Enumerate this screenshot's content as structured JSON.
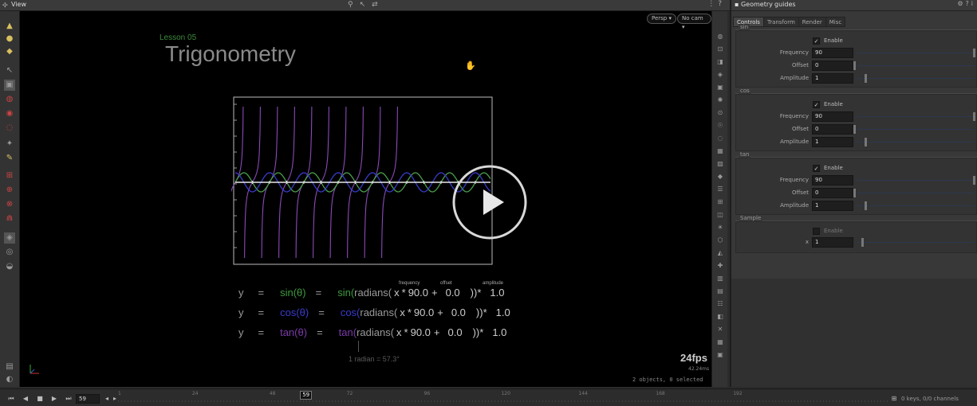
{
  "topbar": {
    "tab_title": "View"
  },
  "viewport": {
    "persp_label": "Persp",
    "cam_label": "No cam",
    "lesson": "Lesson 05",
    "title": "Trigonometry",
    "equations": [
      {
        "y": "y",
        "eq1": "=",
        "func": "sin(θ)",
        "eq2": "=",
        "func2": "sin(",
        "radians": "radians(",
        "x": "x",
        "times": "*",
        "freq": "90.0",
        "plus": "+",
        "offset": "0.0",
        "close": "))",
        "times2": "*",
        "amp": "1.0",
        "color": "#3e9a3e"
      },
      {
        "y": "y",
        "eq1": "=",
        "func": "cos(θ)",
        "eq2": "=",
        "func2": "cos(",
        "radians": "radians(",
        "x": "x",
        "times": "*",
        "freq": "90.0",
        "plus": "+",
        "offset": "0.0",
        "close": "))",
        "times2": "*",
        "amp": "1.0",
        "color": "#3b3bcc"
      },
      {
        "y": "y",
        "eq1": "=",
        "func": "tan(θ)",
        "eq2": "=",
        "func2": "tan(",
        "radians": "radians(",
        "x": "x",
        "times": "*",
        "freq": "90.0",
        "plus": "+",
        "offset": "0.0",
        "close": "))",
        "times2": "*",
        "amp": "1.0",
        "color": "#7a3aa8"
      }
    ],
    "label_frequency": "frequency",
    "label_offset": "offset",
    "label_amplitude": "amplitude",
    "radian_note": "1 radian = 57.3°",
    "fps": "24fps",
    "ms": "42.24ms",
    "objects": "2 objects, 0 selected",
    "colors": {
      "sin": "#4aa04a",
      "cos": "#3a3acc",
      "tan": "#8a4ab8",
      "axis": "#e0e0e0"
    }
  },
  "panel": {
    "type_label": "Geometry",
    "node_name": "guides",
    "tabs": [
      "Controls",
      "Transform",
      "Render",
      "Misc"
    ],
    "folders": [
      {
        "label": "sin",
        "enable": "Enable",
        "enabled": true,
        "params": [
          {
            "label": "Frequency",
            "value": "90"
          },
          {
            "label": "Offset",
            "value": "0"
          },
          {
            "label": "Amplitude",
            "value": "1"
          }
        ]
      },
      {
        "label": "cos",
        "enable": "Enable",
        "enabled": true,
        "params": [
          {
            "label": "Frequency",
            "value": "90"
          },
          {
            "label": "Offset",
            "value": "0"
          },
          {
            "label": "Amplitude",
            "value": "1"
          }
        ]
      },
      {
        "label": "tan",
        "enable": "Enable",
        "enabled": true,
        "params": [
          {
            "label": "Frequency",
            "value": "90"
          },
          {
            "label": "Offset",
            "value": "0"
          },
          {
            "label": "Amplitude",
            "value": "1"
          }
        ]
      }
    ],
    "sample": {
      "label": "Sample",
      "enable": "Enable",
      "enabled": false,
      "x_label": "x",
      "x_value": "1"
    }
  },
  "timeline": {
    "frame": "59",
    "current_frame": "59",
    "ticks": [
      "1",
      "24",
      "48",
      "72",
      "96",
      "120",
      "144",
      "168",
      "192"
    ],
    "keys_info": "0 keys, 0/0 channels"
  }
}
